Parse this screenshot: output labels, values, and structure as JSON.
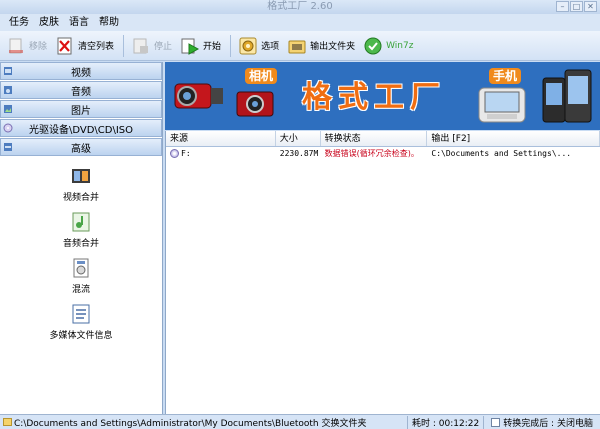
{
  "window": {
    "title": "格式工厂  2.60"
  },
  "menu": [
    "任务",
    "皮肤",
    "语言",
    "帮助"
  ],
  "toolbar": {
    "remove": "移除",
    "clear": "清空列表",
    "stop": "停止",
    "start": "开始",
    "options": "选项",
    "output": "输出文件夹",
    "win7z": "Win7z"
  },
  "categories": [
    "视频",
    "音频",
    "图片",
    "光驱设备\\DVD\\CD\\ISO",
    "高级"
  ],
  "tools": [
    "视频合并",
    "音频合并",
    "混流",
    "多媒体文件信息"
  ],
  "banner": {
    "title": "格式工厂",
    "tag_camera": "相机",
    "tag_phone": "手机"
  },
  "filelist": {
    "headers": [
      "来源",
      "大小",
      "转换状态",
      "输出 [F2]"
    ],
    "rows": [
      {
        "source": "F:",
        "size": "2230.87M",
        "status": "数据错误(循环冗余检查)。",
        "output": "C:\\Documents and Settings\\..."
      }
    ]
  },
  "statusbar": {
    "path": "C:\\Documents and Settings\\Administrator\\My Documents\\Bluetooth 交换文件夹",
    "time_label": "耗时 : 00:12:22",
    "after_label": "转换完成后 : 关闭电脑"
  },
  "colors": {
    "accent": "#2e6fbf",
    "error": "#c8001a",
    "banner_title": "#f06d12"
  }
}
